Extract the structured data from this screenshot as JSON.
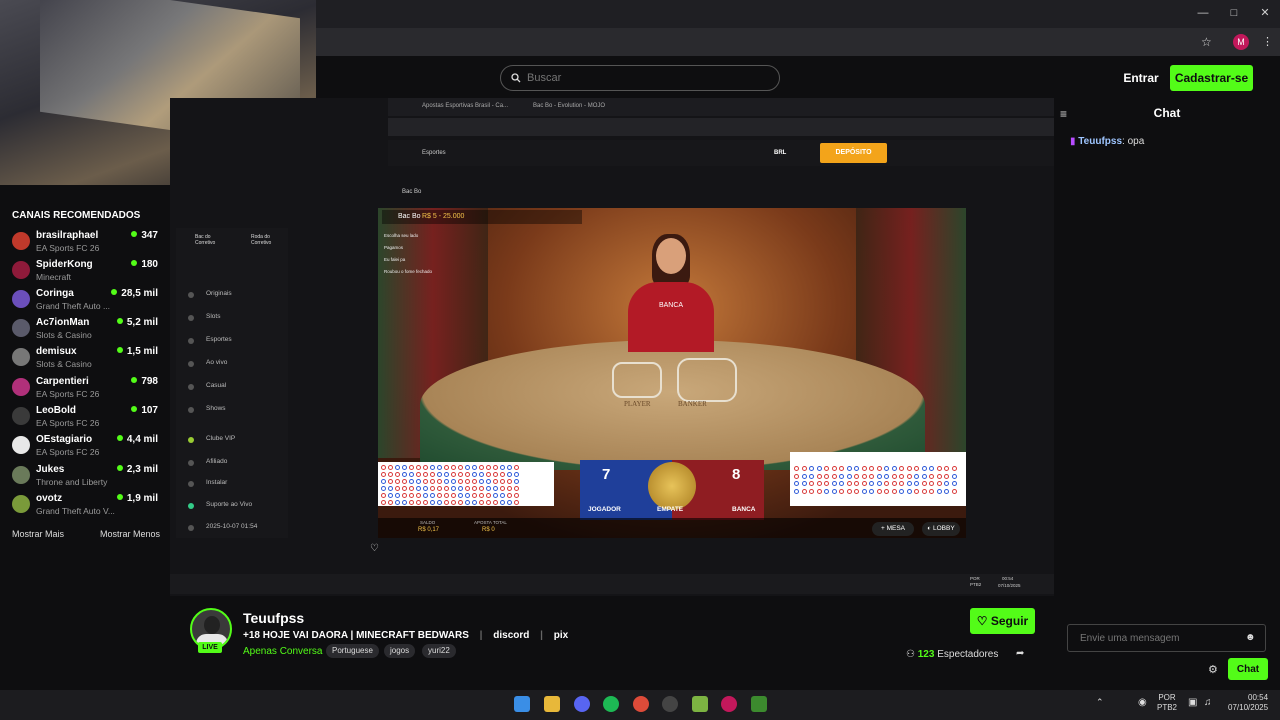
{
  "browser": {
    "avatar_letter": "M"
  },
  "header": {
    "search_placeholder": "Buscar",
    "login_label": "Entrar",
    "signup_label": "Cadastrar-se"
  },
  "sidebar": {
    "title": "CANAIS RECOMENDADOS",
    "channels": [
      {
        "name": "brasilraphael",
        "game": "EA Sports FC 26",
        "viewers": "347",
        "color": "#c0392b"
      },
      {
        "name": "SpiderKong",
        "game": "Minecraft",
        "viewers": "180",
        "color": "#8e1a3a"
      },
      {
        "name": "Coringa",
        "game": "Grand Theft Auto ...",
        "viewers": "28,5 mil",
        "color": "#6b4fbb"
      },
      {
        "name": "Ac7ionMan",
        "game": "Slots & Casino",
        "viewers": "5,2 mil",
        "color": "#5a5a6a"
      },
      {
        "name": "demisux",
        "game": "Slots & Casino",
        "viewers": "1,5 mil",
        "color": "#777777"
      },
      {
        "name": "Carpentieri",
        "game": "EA Sports FC 26",
        "viewers": "798",
        "color": "#b0307a"
      },
      {
        "name": "LeoBold",
        "game": "EA Sports FC 26",
        "viewers": "107",
        "color": "#3a3a3a"
      },
      {
        "name": "OEstagiario",
        "game": "EA Sports FC 26",
        "viewers": "4,4 mil",
        "color": "#e8e8e8"
      },
      {
        "name": "Jukes",
        "game": "Throne and Liberty",
        "viewers": "2,3 mil",
        "color": "#6a7a5a"
      },
      {
        "name": "ovotz",
        "game": "Grand Theft Auto V...",
        "viewers": "1,9 mil",
        "color": "#7a9a3a"
      }
    ],
    "show_more": "Mostrar Mais",
    "show_less": "Mostrar Menos"
  },
  "stream": {
    "inner_tab1": "Apostas Esportivas Brasil - Ca...",
    "inner_tab2": "Bac Bo - Evolution - MOJO",
    "inner_nav_esportes": "Esportes",
    "inner_currency": "BRL",
    "deposit_label": "DEPÓSITO",
    "breadcrumb": "Bac Bo",
    "casino_menu_top": [
      "Bac do Corretivo",
      "Roda do Corretivo"
    ],
    "casino_menu": [
      "Originais",
      "Slots",
      "Esportes",
      "Ao vivo",
      "Casual",
      "Shows",
      "Clube VIP",
      "Afiliado",
      "Instalar",
      "Suporte ao Vivo",
      "2025-10-07 01:54"
    ],
    "game_title": "Bac Bo",
    "game_limits": "R$ 5 - 25.000",
    "side_notes": [
      "Escolha seu lado",
      "Pagamos",
      "Eu falei pa",
      "Roubou o fome fechado"
    ],
    "dealer_label": "BANCA",
    "table_player": "PLAYER",
    "table_banker": "BANKER",
    "player_score": "7",
    "banker_score": "8",
    "player_label": "JOGADOR",
    "tie_label": "EMPATE",
    "banker_label": "BANCA",
    "balance_label": "SALDO",
    "balance_value": "R$ 0,17",
    "bet_label": "APOSTA TOTAL",
    "bet_value": "R$ 0",
    "mesa_label": "MESA",
    "lobby_label": "LOBBY",
    "inner_lang": "POR PTB2",
    "inner_time": "00:54",
    "inner_date": "07/10/2025"
  },
  "channel": {
    "name": "Teuufpss",
    "live_label": "LIVE",
    "stream_title": "+18 HOJE VAI DAORA | MINECRAFT BEDWARS",
    "link1": "discord",
    "link2": "pix",
    "category": "Apenas Conversa",
    "tags": [
      "Portuguese",
      "jogos",
      "yuri22"
    ],
    "follow_label": "Seguir",
    "viewer_count": "123",
    "viewer_label": "Espectadores"
  },
  "chat": {
    "title": "Chat",
    "message_user": "Teuufpss",
    "message_text": "opa",
    "input_placeholder": "Envie uma mensagem",
    "send_label": "Chat"
  },
  "taskbar": {
    "lang_line1": "POR",
    "lang_line2": "PTB2",
    "time": "00:54",
    "date": "07/10/2025"
  }
}
